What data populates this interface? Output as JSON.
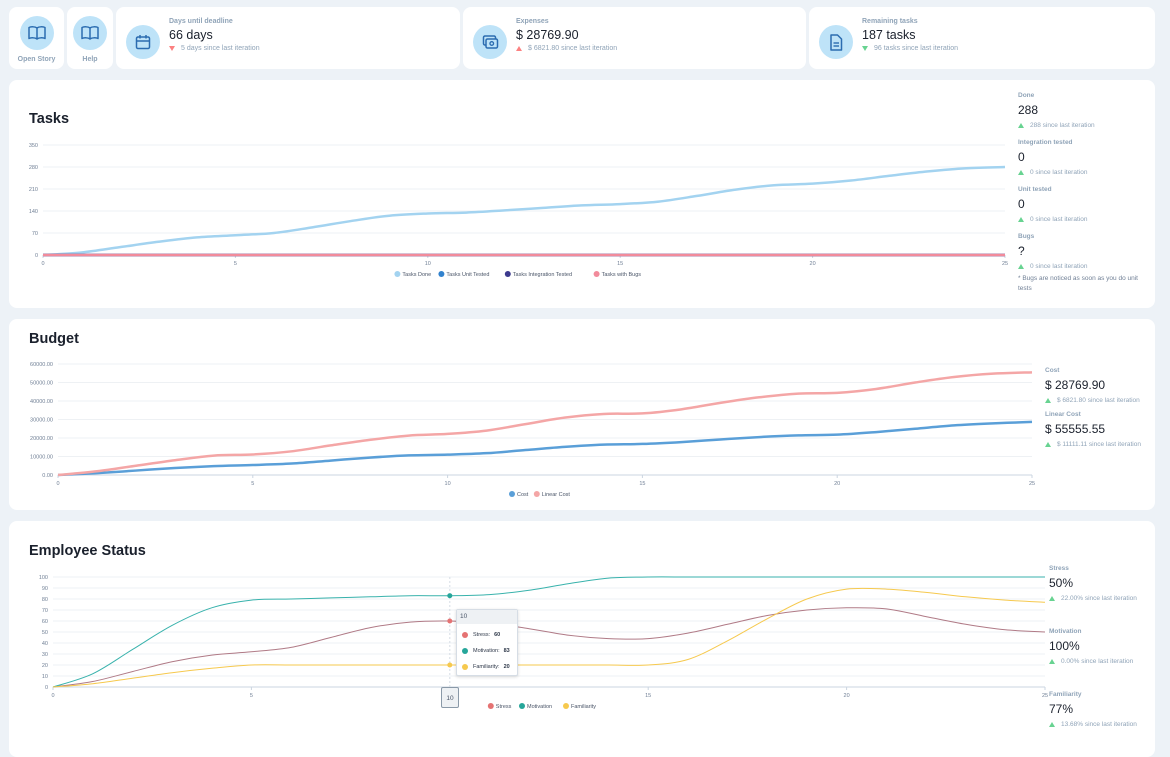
{
  "toolbar": {
    "open_story_label": "Open Story",
    "help_label": "Help"
  },
  "stats": {
    "deadline": {
      "label": "Days until deadline",
      "value": "66 days",
      "delta": "5 days since last iteration"
    },
    "expenses": {
      "label": "Expenses",
      "value": "$ 28769.90",
      "delta": "$ 6821.80 since last iteration"
    },
    "remaining": {
      "label": "Remaining tasks",
      "value": "187 tasks",
      "delta": "96 tasks since last iteration"
    }
  },
  "tasks": {
    "title": "Tasks",
    "side": {
      "done": {
        "label": "Done",
        "value": "288",
        "delta": "288 since last iteration"
      },
      "integration": {
        "label": "Integration tested",
        "value": "0",
        "delta": "0 since last iteration"
      },
      "unit": {
        "label": "Unit tested",
        "value": "0",
        "delta": "0 since last iteration"
      },
      "bugs": {
        "label": "Bugs",
        "value": "?",
        "delta": "0 since last iteration",
        "note": "* Bugs are noticed as soon as you do unit tests"
      }
    }
  },
  "budget": {
    "title": "Budget",
    "side": {
      "cost": {
        "label": "Cost",
        "value": "$ 28769.90",
        "delta": "$ 6821.80 since last iteration"
      },
      "linear": {
        "label": "Linear Cost",
        "value": "$ 55555.55",
        "delta": "$ 11111.11 since last iteration"
      }
    }
  },
  "employee": {
    "title": "Employee Status",
    "side": {
      "stress": {
        "label": "Stress",
        "value": "50%",
        "delta": "22.00% since last iteration"
      },
      "motivation": {
        "label": "Motivation",
        "value": "100%",
        "delta": "0.00% since last iteration"
      },
      "familiarity": {
        "label": "Familiarity",
        "value": "77%",
        "delta": "13.68% since last iteration"
      }
    },
    "tooltip": {
      "title": "10",
      "rows": [
        {
          "label": "Stress:",
          "value": "60",
          "color": "#e57373"
        },
        {
          "label": "Motivation:",
          "value": "83",
          "color": "#26a69a"
        },
        {
          "label": "Familiarity:",
          "value": "20",
          "color": "#f6c94e"
        }
      ]
    },
    "hover_x_label": "10"
  },
  "chart_data": [
    {
      "type": "line",
      "x": [
        0,
        1,
        2,
        3,
        4,
        5,
        6,
        7,
        8,
        9,
        10,
        11,
        12,
        13,
        14,
        15,
        16,
        17,
        18,
        19,
        20,
        21,
        22,
        23,
        24,
        25
      ],
      "xticks": [
        "0",
        "5",
        "10",
        "15",
        "20",
        "25"
      ],
      "yticks": [
        "0",
        "70",
        "140",
        "210",
        "280",
        "350"
      ],
      "ylim": [
        0,
        350
      ],
      "xlim": [
        0,
        25
      ],
      "series": [
        {
          "name": "Tasks Done",
          "color": "#a3d3f0",
          "values": [
            0,
            8,
            25,
            42,
            56,
            63,
            70,
            88,
            108,
            125,
            132,
            135,
            142,
            150,
            158,
            162,
            170,
            188,
            208,
            222,
            227,
            237,
            252,
            266,
            276,
            280
          ]
        },
        {
          "name": "Tasks Unit Tested",
          "color": "#3182ce",
          "values": [
            0,
            0,
            0,
            0,
            0,
            0,
            0,
            0,
            0,
            0,
            0,
            0,
            0,
            0,
            0,
            0,
            0,
            0,
            0,
            0,
            0,
            0,
            0,
            0,
            0,
            0
          ]
        },
        {
          "name": "Tasks Integration Tested",
          "color": "#3c3a8e",
          "values": [
            0,
            0,
            0,
            0,
            0,
            0,
            0,
            0,
            0,
            0,
            0,
            0,
            0,
            0,
            0,
            0,
            0,
            0,
            0,
            0,
            0,
            0,
            0,
            0,
            0,
            0
          ]
        },
        {
          "name": "Tasks with Bugs",
          "color": "#f28b9b",
          "values": [
            0,
            0,
            0,
            0,
            0,
            0,
            0,
            0,
            0,
            0,
            0,
            0,
            0,
            0,
            0,
            0,
            0,
            0,
            0,
            0,
            0,
            0,
            0,
            0,
            0,
            0
          ]
        }
      ]
    },
    {
      "type": "line",
      "x": [
        0,
        1,
        2,
        3,
        4,
        5,
        6,
        7,
        8,
        9,
        10,
        11,
        12,
        13,
        14,
        15,
        16,
        17,
        18,
        19,
        20,
        21,
        22,
        23,
        24,
        25
      ],
      "xticks": [
        "0",
        "5",
        "10",
        "15",
        "20",
        "25"
      ],
      "yticks": [
        "0.00",
        "10000.00",
        "20000.00",
        "30000.00",
        "40000.00",
        "50000.00",
        "60000.00"
      ],
      "ylim": [
        0,
        60000
      ],
      "xlim": [
        0,
        25
      ],
      "series": [
        {
          "name": "Cost",
          "color": "#5a9fd8",
          "values": [
            0,
            1000,
            2400,
            3800,
            4800,
            5400,
            6200,
            7800,
            9400,
            10600,
            11000,
            11800,
            13500,
            15200,
            16400,
            16800,
            17800,
            19200,
            20500,
            21400,
            21800,
            23200,
            25000,
            26800,
            27900,
            28700
          ]
        },
        {
          "name": "Linear Cost",
          "color": "#f4a6a6",
          "values": [
            0,
            2000,
            5000,
            8000,
            10500,
            11100,
            12800,
            16000,
            19000,
            21300,
            22200,
            24000,
            27500,
            31000,
            33000,
            33300,
            35500,
            39000,
            42000,
            44000,
            44400,
            46500,
            50000,
            53000,
            54800,
            55500
          ]
        }
      ]
    },
    {
      "type": "line",
      "x": [
        0,
        1,
        2,
        3,
        4,
        5,
        6,
        7,
        8,
        9,
        10,
        11,
        12,
        13,
        14,
        15,
        16,
        17,
        18,
        19,
        20,
        21,
        22,
        23,
        24,
        25
      ],
      "xticks": [
        "0",
        "5",
        "10",
        "15",
        "20",
        "25"
      ],
      "yticks": [
        "0",
        "10",
        "20",
        "30",
        "40",
        "50",
        "60",
        "70",
        "80",
        "90",
        "100"
      ],
      "ylim": [
        0,
        100
      ],
      "xlim": [
        0,
        25
      ],
      "series": [
        {
          "name": "Stress",
          "color": "#b07a86",
          "values": [
            0,
            5,
            14,
            23,
            29,
            32,
            36,
            45,
            54,
            59,
            60,
            58,
            53,
            47,
            44,
            44,
            49,
            57,
            65,
            70,
            72,
            71,
            64,
            57,
            52,
            50
          ]
        },
        {
          "name": "Motivation",
          "color": "#38b2ac",
          "values": [
            0,
            12,
            34,
            56,
            72,
            79,
            80,
            81,
            82,
            83,
            83,
            84,
            88,
            94,
            99,
            100,
            100,
            100,
            100,
            100,
            100,
            100,
            100,
            100,
            100,
            100
          ]
        },
        {
          "name": "Familiarity",
          "color": "#f6c94e",
          "values": [
            0,
            3,
            8,
            13,
            17,
            20,
            20,
            20,
            20,
            20,
            20,
            20,
            20,
            20,
            20,
            20,
            25,
            42,
            62,
            80,
            89,
            89,
            86,
            82,
            79,
            77
          ]
        }
      ],
      "legend_colors": [
        "#e57373",
        "#26a69a",
        "#f6c94e"
      ]
    }
  ]
}
